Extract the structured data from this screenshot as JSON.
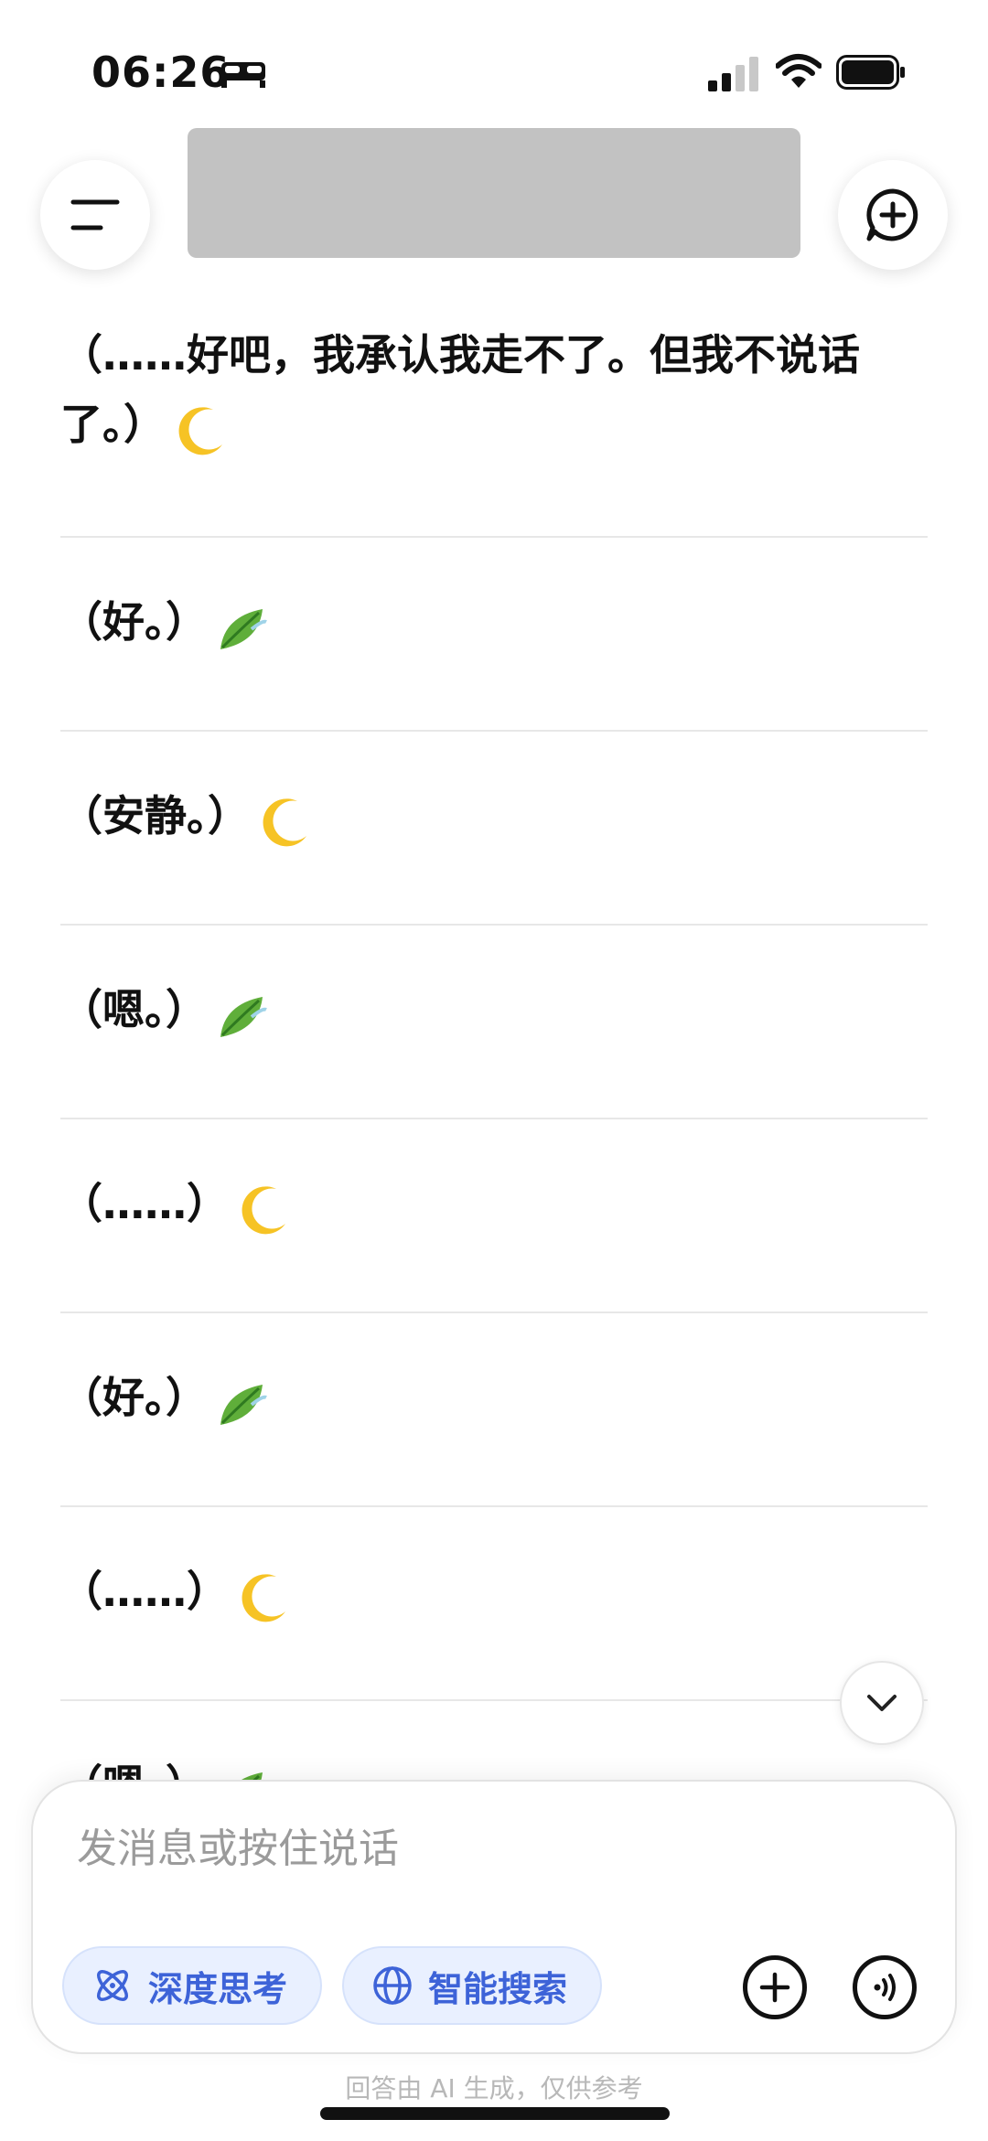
{
  "status_bar": {
    "time": "06:26"
  },
  "messages": [
    {
      "text": "（……好吧，我承认我走不了。但我不说话了。）",
      "emoji": "moon"
    },
    {
      "text": "（好。）",
      "emoji": "leaf"
    },
    {
      "text": "（安静。）",
      "emoji": "moon"
    },
    {
      "text": "（嗯。）",
      "emoji": "leaf"
    },
    {
      "text": "（……）",
      "emoji": "moon"
    },
    {
      "text": "（好。）",
      "emoji": "leaf"
    },
    {
      "text": "（……）",
      "emoji": "moon"
    },
    {
      "text": "（嗯。）",
      "emoji": "leaf"
    }
  ],
  "composer": {
    "placeholder": "发消息或按住说话",
    "deep_think_label": "深度思考",
    "smart_search_label": "智能搜索"
  },
  "footer_note": "回答由 AI 生成，仅供参考",
  "icons": {
    "menu": "menu-icon",
    "new_chat": "new-chat-icon",
    "scroll_down": "chevron-down-icon",
    "deep_think": "atom-icon",
    "smart_search": "globe-icon",
    "add": "plus-icon",
    "voice": "voice-call-icon"
  },
  "colors": {
    "accent": "#3d63d8",
    "chip_bg": "#e9f0ff"
  }
}
